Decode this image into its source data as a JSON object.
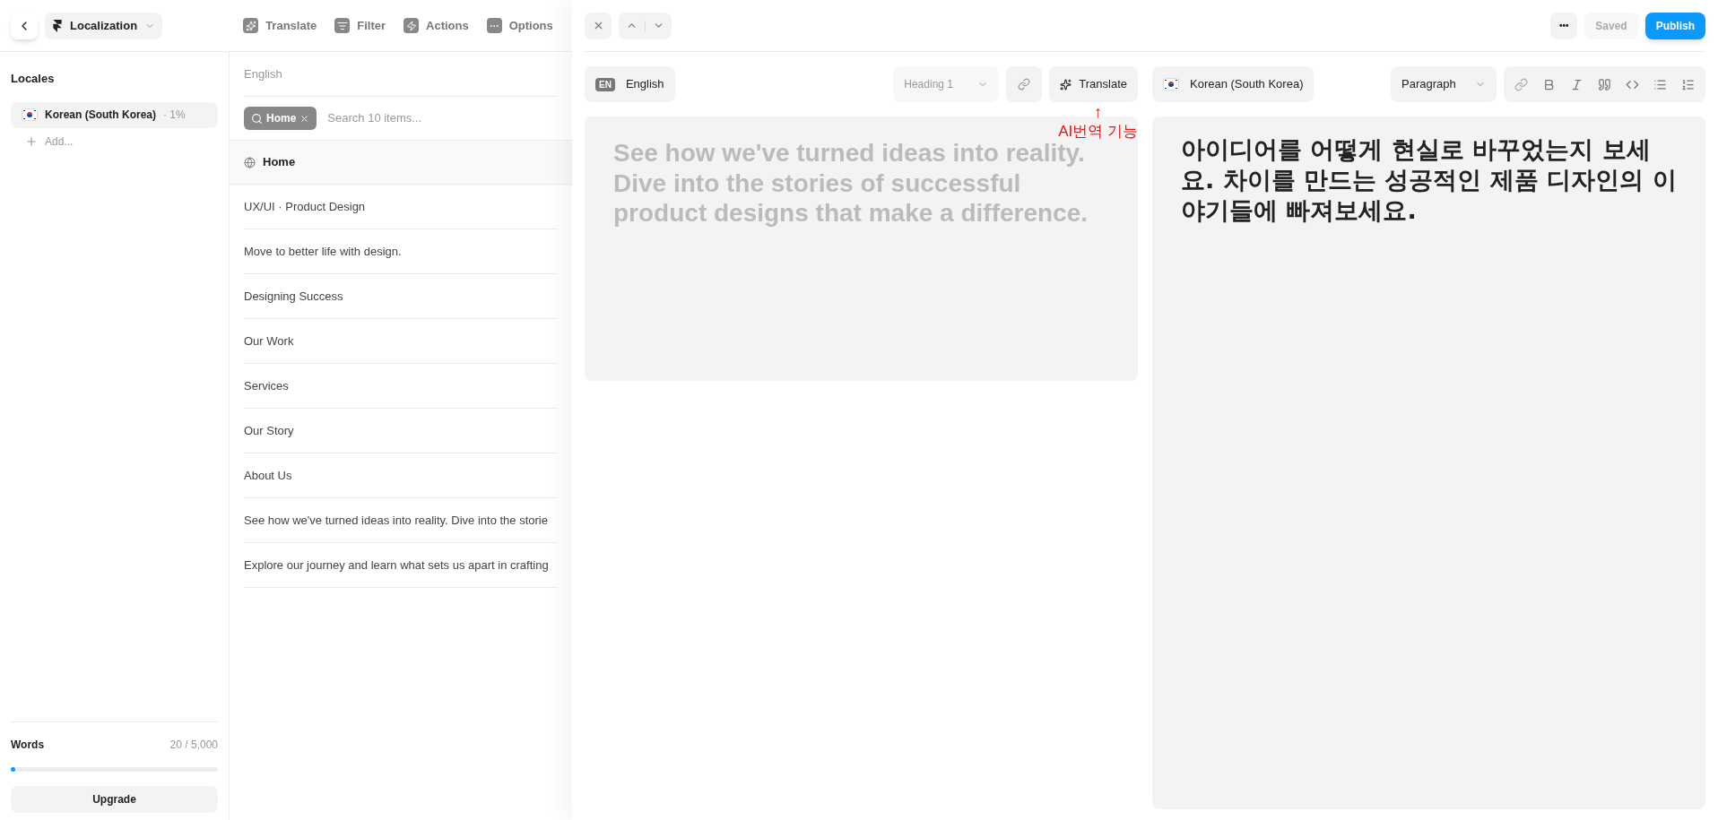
{
  "app_bar": {
    "project": "Localization",
    "actions": [
      {
        "kind": "translate",
        "label": "Translate"
      },
      {
        "kind": "filter",
        "label": "Filter"
      },
      {
        "kind": "actions",
        "label": "Actions"
      },
      {
        "kind": "options",
        "label": "Options"
      }
    ]
  },
  "sidebar": {
    "title": "Locales",
    "locales": [
      {
        "name": "Korean (South Korea)",
        "progress": "· 1%",
        "selected": true
      }
    ],
    "add_label": "Add...",
    "words": {
      "label": "Words",
      "count": "20 / 5,000",
      "level": 0.01
    },
    "upgrade": "Upgrade"
  },
  "list": {
    "source_locale": "English",
    "filter_chip": "Home",
    "search_placeholder": "Search 10 items...",
    "group": "Home",
    "items": [
      "UX/UI · Product Design",
      "Move to better life with design.",
      "Designing Success",
      "Our Work",
      "Services",
      "Our Story",
      "About Us",
      "See how we've turned ideas into reality. Dive into the storie",
      "Explore our journey and learn what sets us apart in crafting"
    ]
  },
  "editor": {
    "more": "•••",
    "saved": "Saved",
    "publish": "Publish",
    "source": {
      "badge": "EN",
      "language": "English",
      "style": "Heading 1",
      "translate": "Translate",
      "text": "See how we've turned ideas into reality. Dive into the stories of successful product designs that make a difference."
    },
    "target": {
      "language": "Korean (South Korea)",
      "style": "Paragraph",
      "text": "아이디어를 어떻게 현실로 바꾸었는지 보세요. 차이를 만드는 성공적인 제품 디자인의 이야기들에 빠져보세요."
    },
    "annotation": {
      "arrow": "↑",
      "text": "AI번역 기능"
    }
  }
}
